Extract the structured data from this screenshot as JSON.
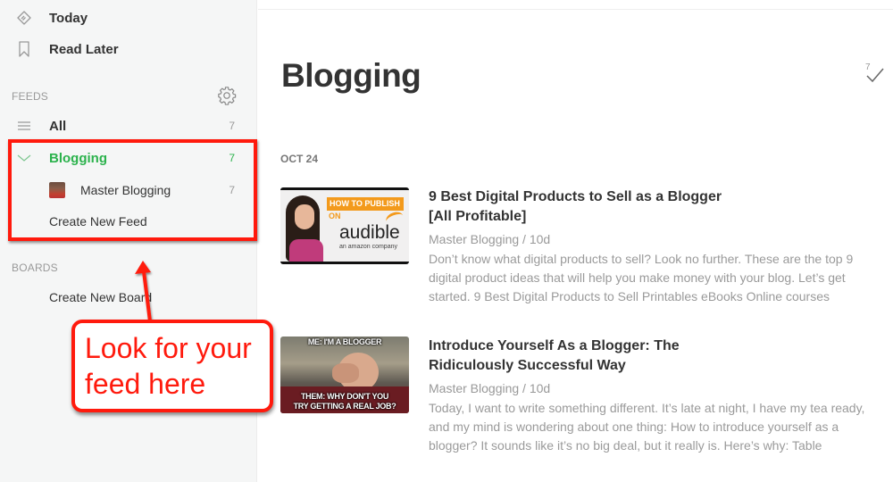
{
  "sidebar": {
    "nav": [
      {
        "label": "Today",
        "icon": "feedly-today-icon"
      },
      {
        "label": "Read Later",
        "icon": "bookmark-icon"
      }
    ],
    "feeds_title": "FEEDS",
    "all": {
      "label": "All",
      "count": "7"
    },
    "blogging": {
      "label": "Blogging",
      "count": "7",
      "color": "#2bb24c"
    },
    "master_blogging": {
      "label": "Master Blogging",
      "count": "7"
    },
    "create_feed": "Create New Feed",
    "boards_title": "BOARDS",
    "create_board": "Create New Board"
  },
  "annotation": {
    "callout_line1": "Look for your",
    "callout_line2": "feed here",
    "color": "#ff1a0d"
  },
  "main": {
    "title": "Blogging",
    "unread_count": "7",
    "date_label": "OCT 24",
    "articles": [
      {
        "title_line1": "9 Best Digital Products to Sell as a Blogger",
        "title_line2": "[All Profitable]",
        "meta": "Master Blogging / 10d",
        "summary": "Don’t know what digital products to sell? Look no further. These are the top 9 digital product ideas that will help you make money with your blog. Let’s get started. 9 Best Digital Products to Sell Printables eBooks Online courses",
        "thumb": {
          "banner": "HOW TO PUBLISH",
          "on": "ON",
          "brand": "audible",
          "sub": "an amazon company"
        }
      },
      {
        "title_line1": "Introduce Yourself As a Blogger: The",
        "title_line2": "Ridiculously Successful Way",
        "meta": "Master Blogging / 10d",
        "summary": "Today, I want to write something different. It’s late at night, I have my tea ready, and my mind is wondering about one thing: How to introduce yourself as a blogger? It sounds like it’s no big deal, but it really is. Here’s why: Table",
        "thumb": {
          "top_caption": "ME: I'M A BLOGGER",
          "bottom_caption_1": "THEM: WHY DON'T YOU",
          "bottom_caption_2": "TRY GETTING A REAL JOB?"
        }
      }
    ]
  }
}
